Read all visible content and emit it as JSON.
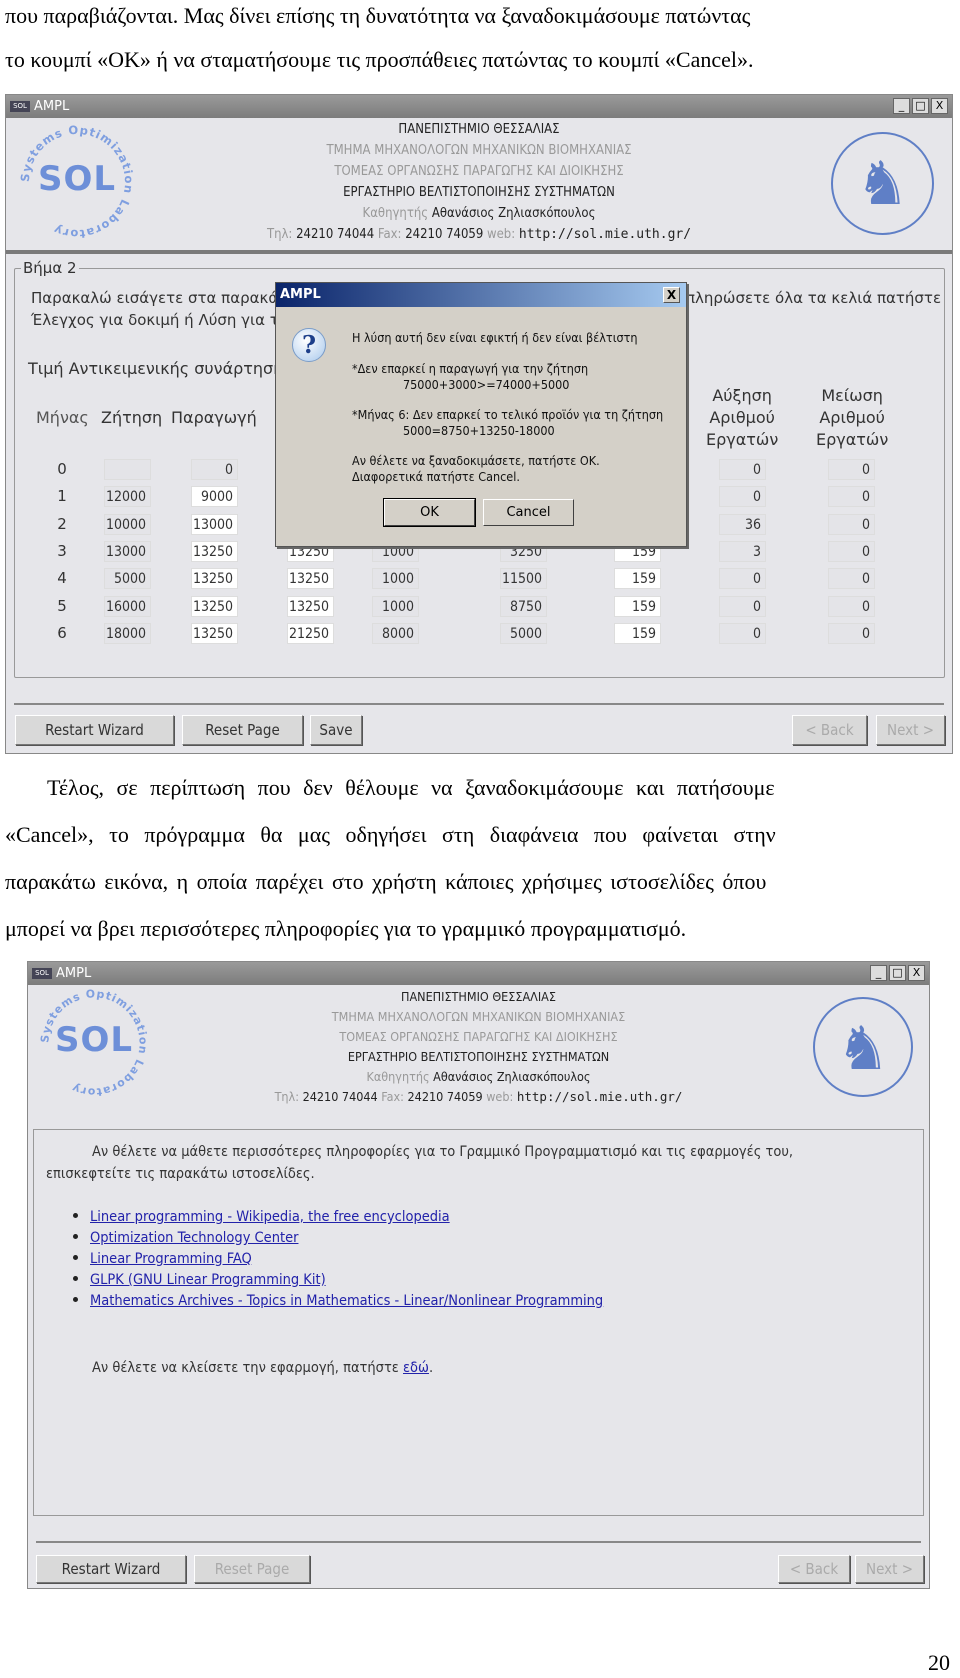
{
  "doc": {
    "para1_lines": [
      "που παραβιάζονται. Μας δίνει επίσης τη δυνατότητα να ξαναδοκιμάσουμε πατώντας",
      "το κουμπί «OK» ή να σταματήσουμε τις προσπάθειες πατώντας το κουμπί «Cancel»."
    ],
    "para2_lines": [
      "Τέλος, σε περίπτωση που δεν θέλουμε να ξαναδοκιμάσουμε και πατήσουμε",
      "«Cancel», το πρόγραμμα θα μας οδηγήσει στη διαφάνεια που φαίνεται στην",
      "παρακάτω εικόνα, η οποία παρέχει στο χρήστη κάποιες χρήσιμες ιστοσελίδες όπου",
      "μπορεί να βρει περισσότερες πληροφορίες για το γραμμικό προγραμματισμό."
    ],
    "page_number": "20"
  },
  "app": {
    "title": "AMPL",
    "icon_label": "SOL",
    "window_buttons": [
      "_",
      "□",
      "X"
    ],
    "header": {
      "university": "ΠΑΝΕΠΙΣΤΗΜΙΟ ΘΕΣΣΑΛΙΑΣ",
      "department": "ΤΜΗΜΑ ΜΗΧΑΝΟΛΟΓΩΝ ΜΗΧΑΝΙΚΩΝ ΒΙΟΜΗΧΑΝΙΑΣ",
      "division": "ΤΟΜΕΑΣ ΟΡΓΑΝΩΣΗΣ ΠΑΡΑΓΩΓΗΣ ΚΑΙ ΔΙΟΙΚΗΣΗΣ",
      "lab": "ΕΡΓΑΣΤΗΡΙΟ ΒΕΛΤΙΣΤΟΠΟΙΗΣΗΣ ΣΥΣΤΗΜΑΤΩΝ",
      "professor_label": "Καθηγητής",
      "professor": "Αθανάσιος Ζηλιασκόπουλος",
      "tel_label": "Τηλ:",
      "tel": "24210 74044",
      "fax_label": "Fax:",
      "fax": "24210 74059",
      "web_label": "web:",
      "web": "http://sol.mie.uth.gr/",
      "left_logo": "SOL",
      "left_logo_ring": "Systems Optimization Laboratory",
      "right_logo": "centaur-seal"
    },
    "buttons": {
      "restart": "Restart Wizard",
      "reset": "Reset Page",
      "save": "Save",
      "back": "< Back",
      "next": "Next >"
    }
  },
  "step2": {
    "group_label": "Βήμα 2",
    "instr1_left": "Παρακαλώ εισάγετε στα παρακάτω",
    "instr1_right": "πληρώσετε όλα τα κελιά πατήστε",
    "instr2_left": "Έλεγχος για δοκιμή ή Λύση για την",
    "objective_label": "Τιμή Αντικειμενικής συνάρτηση",
    "headers": {
      "month": "Μήνας",
      "demand": "Ζήτηση",
      "production": "Παραγωγή",
      "hire": [
        "Αύξηση",
        "Αριθμού",
        "Εργατών"
      ],
      "fire": [
        "Μείωση",
        "Αριθμού",
        "Εργατών"
      ]
    },
    "rows": [
      [
        "0",
        "",
        "0",
        "",
        "",
        "",
        "",
        "0",
        "0"
      ],
      [
        "1",
        "12000",
        "9000",
        "",
        "",
        "",
        "",
        "0",
        "0"
      ],
      [
        "2",
        "10000",
        "13000",
        "",
        "",
        "",
        "",
        "36",
        "0"
      ],
      [
        "3",
        "13000",
        "13250",
        "13250",
        "1000",
        "3250",
        "159",
        "3",
        "0"
      ],
      [
        "4",
        "5000",
        "13250",
        "13250",
        "1000",
        "11500",
        "159",
        "0",
        "0"
      ],
      [
        "5",
        "16000",
        "13250",
        "13250",
        "1000",
        "8750",
        "159",
        "0",
        "0"
      ],
      [
        "6",
        "18000",
        "13250",
        "21250",
        "8000",
        "5000",
        "159",
        "0",
        "0"
      ]
    ]
  },
  "dialog": {
    "title": "AMPL",
    "close": "X",
    "icon": "question-icon",
    "line1": "Η λύση αυτή δεν είναι εφικτή ή δεν είναι βέλτιστη",
    "line2": "*Δεν επαρκεί η παραγωγή για την ζήτηση",
    "line3": "75000+3000>=74000+5000",
    "line4": "*Μήνας 6: Δεν επαρκεί το τελικό προϊόν για τη ζήτηση",
    "line5": "5000=8750+13250-18000",
    "line6": "Αν θέλετε να ξαναδοκιμάσετε, πατήστε OK.",
    "line7": "Διαφορετικά πατήστε Cancel.",
    "ok": "OK",
    "cancel": "Cancel"
  },
  "links_page": {
    "intro1": "Αν θέλετε να μάθετε περισσότερες πληροφορίες για το Γραμμικό Προγραμματισμό και τις εφαρμογές του,",
    "intro2": "επισκεφτείτε τις παρακάτω ιστοσελίδες.",
    "links": [
      "Linear programming - Wikipedia, the free encyclopedia",
      "Optimization Technology Center",
      "Linear Programming FAQ",
      "GLPK (GNU Linear Programming Kit)",
      "Mathematics Archives - Topics in Mathematics - Linear/Nonlinear Programming"
    ],
    "close_text": "Αν θέλετε να κλείσετε την εφαρμογή, πατήστε",
    "close_link": "εδώ",
    "close_end": "."
  }
}
